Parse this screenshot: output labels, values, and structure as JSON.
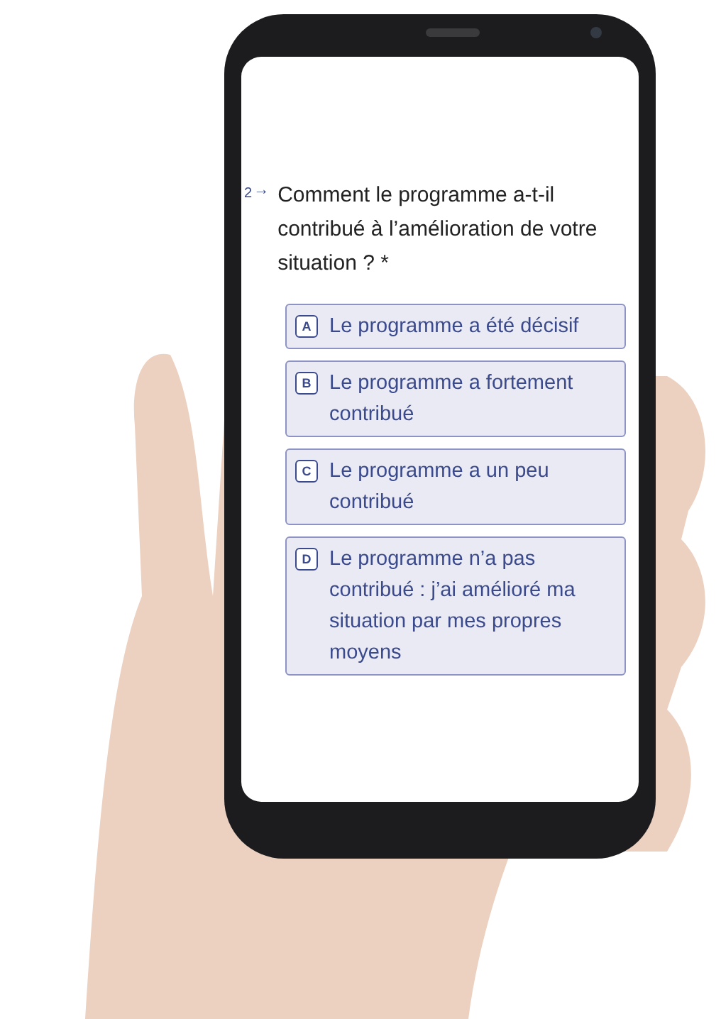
{
  "question": {
    "number": "2",
    "arrow": "→",
    "text": "Comment le programme a-t-il contribué à l’amélioration de votre situation ? *"
  },
  "options": [
    {
      "key": "A",
      "label": "Le programme a été décisif"
    },
    {
      "key": "B",
      "label": "Le programme a fortement contribué"
    },
    {
      "key": "C",
      "label": "Le programme a un peu contribué"
    },
    {
      "key": "D",
      "label": "Le programme n’a pas contribué : j’ai amélioré ma situation par mes propres moyens"
    }
  ]
}
